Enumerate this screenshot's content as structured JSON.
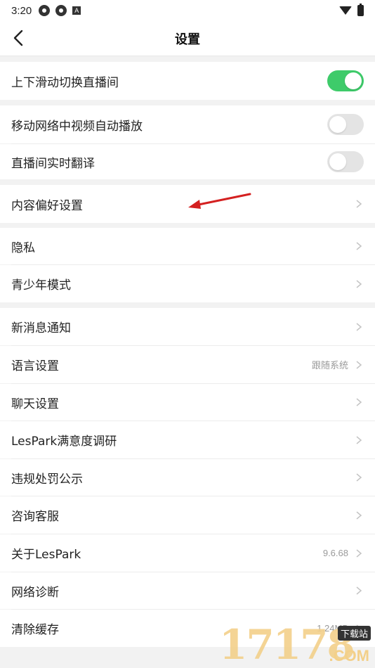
{
  "status_bar": {
    "time": "3:20",
    "a_icon": "A"
  },
  "nav": {
    "title": "设置"
  },
  "settings": {
    "swipe_switch": {
      "label": "上下滑动切换直播间",
      "enabled": true
    },
    "mobile_autoplay": {
      "label": "移动网络中视频自动播放",
      "enabled": false
    },
    "live_translate": {
      "label": "直播间实时翻译",
      "enabled": false
    },
    "content_pref": {
      "label": "内容偏好设置"
    },
    "privacy": {
      "label": "隐私"
    },
    "teen_mode": {
      "label": "青少年模式"
    },
    "notifications": {
      "label": "新消息通知"
    },
    "language": {
      "label": "语言设置",
      "value": "跟随系统"
    },
    "chat": {
      "label": "聊天设置"
    },
    "survey": {
      "label": "LesPark满意度调研"
    },
    "violation": {
      "label": "违规处罚公示"
    },
    "support": {
      "label": "咨询客服"
    },
    "about": {
      "label": "关于LesPark",
      "value": "9.6.68"
    },
    "network": {
      "label": "网络诊断"
    },
    "cache": {
      "label": "清除缓存",
      "value": "1.24MB"
    }
  },
  "colors": {
    "toggle_on": "#3ecb6a",
    "toggle_off": "#e4e4e4",
    "arrow": "#d42020"
  },
  "watermark": {
    "number": "17178",
    "tag": "下载站",
    "domain": ".COM"
  }
}
